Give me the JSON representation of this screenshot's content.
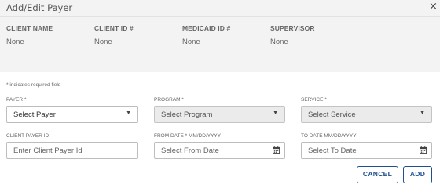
{
  "modal": {
    "title": "Add/Edit Payer",
    "close_glyph": "×"
  },
  "client_info": [
    {
      "label": "CLIENT NAME",
      "value": "None"
    },
    {
      "label": "CLIENT ID #",
      "value": "None"
    },
    {
      "label": "MEDICAID ID #",
      "value": "None"
    },
    {
      "label": "SUPERVISOR",
      "value": "None"
    }
  ],
  "form": {
    "required_note": "* indicates required field",
    "payer": {
      "label": "PAYER *",
      "value": "Select Payer",
      "disabled": false
    },
    "program": {
      "label": "PROGRAM *",
      "value": "Select Program",
      "disabled": true
    },
    "service": {
      "label": "SERVICE *",
      "value": "Select Service",
      "disabled": true
    },
    "client_payer_id": {
      "label": "CLIENT PAYER ID",
      "placeholder": "Enter Client Payer Id"
    },
    "from_date": {
      "label": "FROM DATE * MM/DD/YYYY",
      "placeholder": "Select From Date"
    },
    "to_date": {
      "label": "TO DATE MM/DD/YYYY",
      "placeholder": "Select To Date"
    }
  },
  "actions": {
    "cancel_label": "CANCEL",
    "add_label": "ADD"
  },
  "icons": {
    "dropdown": "chevron-down-icon",
    "calendar": "calendar-icon",
    "close": "close-icon"
  },
  "colors": {
    "primary": "#1f4f8f",
    "header_bg": "#f3f3f3",
    "disabled_bg": "#ebebeb"
  }
}
